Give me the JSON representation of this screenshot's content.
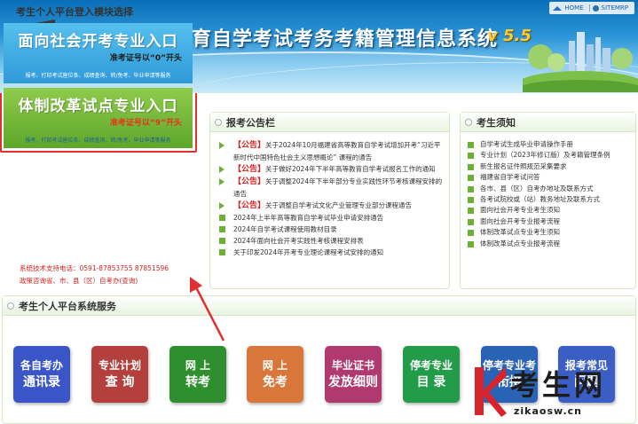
{
  "header": {
    "title": "福建省高等教育自学考试考务考籍管理信息系统",
    "version": "v 5.5",
    "links": {
      "home": "HOME",
      "sitemap": "SITEMRP"
    }
  },
  "login": {
    "title": "考生个人平台登入模块选择",
    "social": {
      "main": "面向社会开考专业入口",
      "sub": "准考证号以“0”开头",
      "services": "报考、打印考试座位条、成绩查询、转/免考、毕业申请等服务"
    },
    "reform": {
      "main": "体制改革试点专业入口",
      "sub": "准考证号以“9”开头",
      "services": "报考、打印考试座位条、成绩查询、转/免考、毕业申请等服务"
    },
    "support1": "系统技术支持电话：0591-87853755 87851596",
    "support2": "政策咨询省、市、县（区）自考办(查询)"
  },
  "notices": {
    "title": "报考公告栏",
    "items": [
      {
        "tag": "【公告】",
        "text": "关于2024年10月福建省高等教育自学考试增加开考“习近平新时代中国特色社会主义思想概论” 课程的通告"
      },
      {
        "tag": "【公告】",
        "text": "关于做好2024年下半年高等教育自学考试报名工作的通知"
      },
      {
        "tag": "【公告】",
        "text": "关于调整2024年下半年部分专业实践性环节考核课程安排的通告"
      },
      {
        "tag": "【公告】",
        "text": "关于调整自学考试文化产业管理专业部分课程通告"
      },
      {
        "tag": "",
        "text": "2024年上半年高等教育自学考试毕业申请安排通告"
      },
      {
        "tag": "",
        "text": "2024年自学考试课程使用教材目录"
      },
      {
        "tag": "",
        "text": "2024年面向社会开考实践性考核课程安排表"
      },
      {
        "tag": "",
        "text": "关于印发2024年开考专业理论课程考试安排的通知"
      }
    ]
  },
  "rules": {
    "title": "考生须知",
    "items": [
      "自学考试生成毕业申请操作手册",
      "专业计划（2023年修订版）及考籍管理条例",
      "新生报名证件照规范采集要求",
      "福建省自学考试问答",
      "各市、县（区）自考办地址及联系方式",
      "各考试院校或（站）教务地址及联系方式",
      "面向社会开考专业考生须知",
      "面向社会开考专业报考流程",
      "体制改革试点专业考生须知",
      "体制改革试点专业报考流程"
    ]
  },
  "services": {
    "title": "考生个人平台系统服务",
    "buttons": [
      {
        "l1": "各自考办",
        "l2": "通讯录",
        "color": "#3a55c8"
      },
      {
        "l1": "专业计划",
        "l2": "查 询",
        "color": "#b3403c"
      },
      {
        "l1": "网 上",
        "l2": "转考",
        "color": "#2f8f2f"
      },
      {
        "l1": "网 上",
        "l2": "免考",
        "color": "#d9763a"
      },
      {
        "l1": "毕业证书",
        "l2": "发放细则",
        "color": "#b03a70"
      },
      {
        "l1": "停考专业",
        "l2": "目 录",
        "color": "#239c4a"
      },
      {
        "l1": "停考专业考",
        "l2": "衔接",
        "color": "#2a63b5"
      },
      {
        "l1": "报考常见",
        "l2": "问题",
        "color": "#3a5ec4"
      }
    ]
  },
  "watermark": {
    "text": "考生网",
    "url": "zikaosw.cn"
  }
}
